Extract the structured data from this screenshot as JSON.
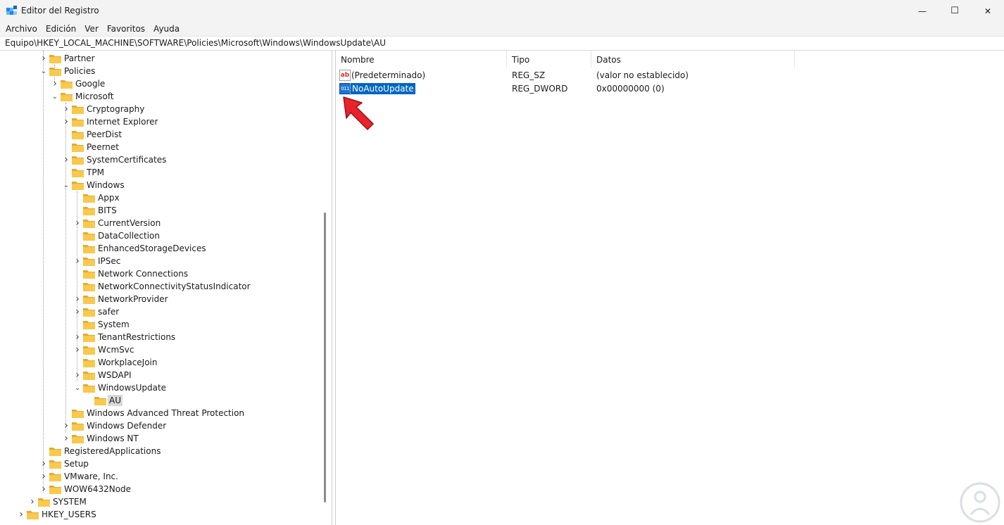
{
  "window": {
    "title": "Editor del Registro",
    "icon": "registry-editor-icon",
    "minimize_icon": "—",
    "maximize_icon": "☐",
    "close_icon": "✕"
  },
  "menu": [
    "Archivo",
    "Edición",
    "Ver",
    "Favoritos",
    "Ayuda"
  ],
  "address": "Equipo\\HKEY_LOCAL_MACHINE\\SOFTWARE\\Policies\\Microsoft\\Windows\\WindowsUpdate\\AU",
  "tree": [
    {
      "label": "Partner",
      "chevron": "›"
    },
    {
      "label": "Policies",
      "chevron": "⌄"
    },
    {
      "label": "Google",
      "chevron": "›"
    },
    {
      "label": "Microsoft",
      "chevron": "⌄"
    },
    {
      "label": "Cryptography",
      "chevron": "›"
    },
    {
      "label": "Internet Explorer",
      "chevron": "›"
    },
    {
      "label": "PeerDist",
      "chevron": ""
    },
    {
      "label": "Peernet",
      "chevron": ""
    },
    {
      "label": "SystemCertificates",
      "chevron": "›"
    },
    {
      "label": "TPM",
      "chevron": ""
    },
    {
      "label": "Windows",
      "chevron": "⌄"
    },
    {
      "label": "Appx",
      "chevron": ""
    },
    {
      "label": "BITS",
      "chevron": ""
    },
    {
      "label": "CurrentVersion",
      "chevron": "›"
    },
    {
      "label": "DataCollection",
      "chevron": ""
    },
    {
      "label": "EnhancedStorageDevices",
      "chevron": ""
    },
    {
      "label": "IPSec",
      "chevron": "›"
    },
    {
      "label": "Network Connections",
      "chevron": ""
    },
    {
      "label": "NetworkConnectivityStatusIndicator",
      "chevron": ""
    },
    {
      "label": "NetworkProvider",
      "chevron": "›"
    },
    {
      "label": "safer",
      "chevron": "›"
    },
    {
      "label": "System",
      "chevron": ""
    },
    {
      "label": "TenantRestrictions",
      "chevron": "›"
    },
    {
      "label": "WcmSvc",
      "chevron": "›"
    },
    {
      "label": "WorkplaceJoin",
      "chevron": ""
    },
    {
      "label": "WSDAPI",
      "chevron": "›"
    },
    {
      "label": "WindowsUpdate",
      "chevron": "⌄"
    },
    {
      "label": "AU",
      "chevron": ""
    },
    {
      "label": "Windows Advanced Threat Protection",
      "chevron": ""
    },
    {
      "label": "Windows Defender",
      "chevron": "›"
    },
    {
      "label": "Windows NT",
      "chevron": "›"
    },
    {
      "label": "RegisteredApplications",
      "chevron": ""
    },
    {
      "label": "Setup",
      "chevron": "›"
    },
    {
      "label": "VMware, Inc.",
      "chevron": "›"
    },
    {
      "label": "WOW6432Node",
      "chevron": "›"
    },
    {
      "label": "SYSTEM",
      "chevron": "›"
    },
    {
      "label": "HKEY_USERS",
      "chevron": "›"
    }
  ],
  "columns": {
    "name": "Nombre",
    "type": "Tipo",
    "data": "Datos"
  },
  "values": [
    {
      "name": "(Predeterminado)",
      "type": "REG_SZ",
      "data": "(valor no establecido)",
      "icon": "string-value-icon",
      "icon_text": "ab"
    },
    {
      "name": "NoAutoUpdate",
      "type": "REG_DWORD",
      "data": "0x00000000 (0)",
      "icon": "binary-value-icon",
      "icon_text": "011"
    }
  ],
  "colors": {
    "selection": "#0067c0",
    "folder": "#f8c94c",
    "arrow": "#e8242a"
  }
}
